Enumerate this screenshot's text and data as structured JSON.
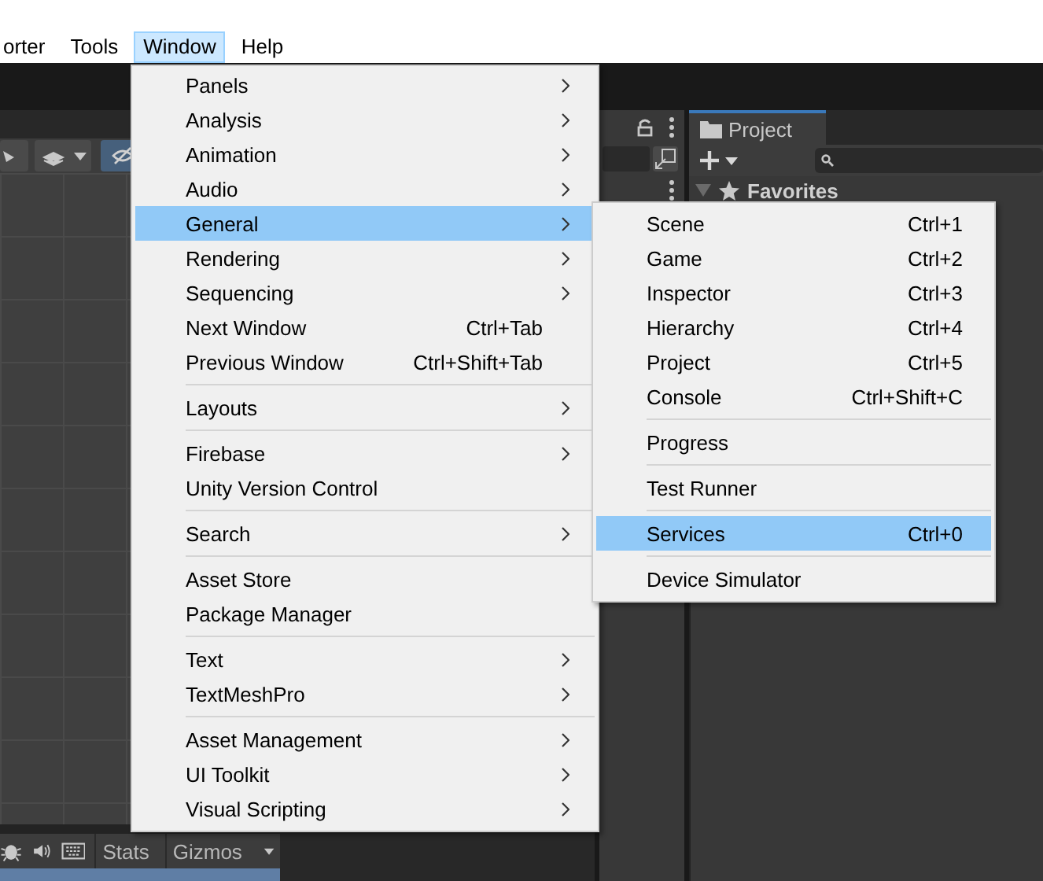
{
  "menubar": [
    {
      "label": "orter",
      "selected": false
    },
    {
      "label": "Tools",
      "selected": false
    },
    {
      "label": "Window",
      "selected": true
    },
    {
      "label": "Help",
      "selected": false
    }
  ],
  "window_menu": [
    {
      "kind": "item",
      "label": "Panels",
      "submenu": true,
      "selected": false
    },
    {
      "kind": "item",
      "label": "Analysis",
      "submenu": true,
      "selected": false
    },
    {
      "kind": "item",
      "label": "Animation",
      "submenu": true,
      "selected": false
    },
    {
      "kind": "item",
      "label": "Audio",
      "submenu": true,
      "selected": false
    },
    {
      "kind": "item",
      "label": "General",
      "submenu": true,
      "selected": true
    },
    {
      "kind": "item",
      "label": "Rendering",
      "submenu": true,
      "selected": false
    },
    {
      "kind": "item",
      "label": "Sequencing",
      "submenu": true,
      "selected": false
    },
    {
      "kind": "item",
      "label": "Next Window",
      "shortcut": "Ctrl+Tab",
      "submenu": false,
      "selected": false
    },
    {
      "kind": "item",
      "label": "Previous Window",
      "shortcut": "Ctrl+Shift+Tab",
      "submenu": false,
      "selected": false
    },
    {
      "kind": "separator"
    },
    {
      "kind": "item",
      "label": "Layouts",
      "submenu": true,
      "selected": false
    },
    {
      "kind": "separator"
    },
    {
      "kind": "item",
      "label": "Firebase",
      "submenu": true,
      "selected": false
    },
    {
      "kind": "item",
      "label": "Unity Version Control",
      "submenu": false,
      "selected": false
    },
    {
      "kind": "separator"
    },
    {
      "kind": "item",
      "label": "Search",
      "submenu": true,
      "selected": false
    },
    {
      "kind": "separator"
    },
    {
      "kind": "item",
      "label": "Asset Store",
      "submenu": false,
      "selected": false
    },
    {
      "kind": "item",
      "label": "Package Manager",
      "submenu": false,
      "selected": false
    },
    {
      "kind": "separator"
    },
    {
      "kind": "item",
      "label": "Text",
      "submenu": true,
      "selected": false
    },
    {
      "kind": "item",
      "label": "TextMeshPro",
      "submenu": true,
      "selected": false
    },
    {
      "kind": "separator"
    },
    {
      "kind": "item",
      "label": "Asset Management",
      "submenu": true,
      "selected": false
    },
    {
      "kind": "item",
      "label": "UI Toolkit",
      "submenu": true,
      "selected": false
    },
    {
      "kind": "item",
      "label": "Visual Scripting",
      "submenu": true,
      "selected": false
    }
  ],
  "general_submenu": [
    {
      "kind": "item",
      "label": "Scene",
      "shortcut": "Ctrl+1",
      "selected": false
    },
    {
      "kind": "item",
      "label": "Game",
      "shortcut": "Ctrl+2",
      "selected": false
    },
    {
      "kind": "item",
      "label": "Inspector",
      "shortcut": "Ctrl+3",
      "selected": false
    },
    {
      "kind": "item",
      "label": "Hierarchy",
      "shortcut": "Ctrl+4",
      "selected": false
    },
    {
      "kind": "item",
      "label": "Project",
      "shortcut": "Ctrl+5",
      "selected": false
    },
    {
      "kind": "item",
      "label": "Console",
      "shortcut": "Ctrl+Shift+C",
      "selected": false
    },
    {
      "kind": "separator"
    },
    {
      "kind": "item",
      "label": "Progress",
      "selected": false
    },
    {
      "kind": "separator"
    },
    {
      "kind": "item",
      "label": "Test Runner",
      "selected": false
    },
    {
      "kind": "separator"
    },
    {
      "kind": "item",
      "label": "Services",
      "shortcut": "Ctrl+0",
      "selected": true
    },
    {
      "kind": "separator"
    },
    {
      "kind": "item",
      "label": "Device Simulator",
      "selected": false
    }
  ],
  "project_panel": {
    "tab": "Project",
    "section": "Favorites"
  },
  "game_toolbar": {
    "buttons": [
      "Stats",
      "Gizmos"
    ]
  }
}
